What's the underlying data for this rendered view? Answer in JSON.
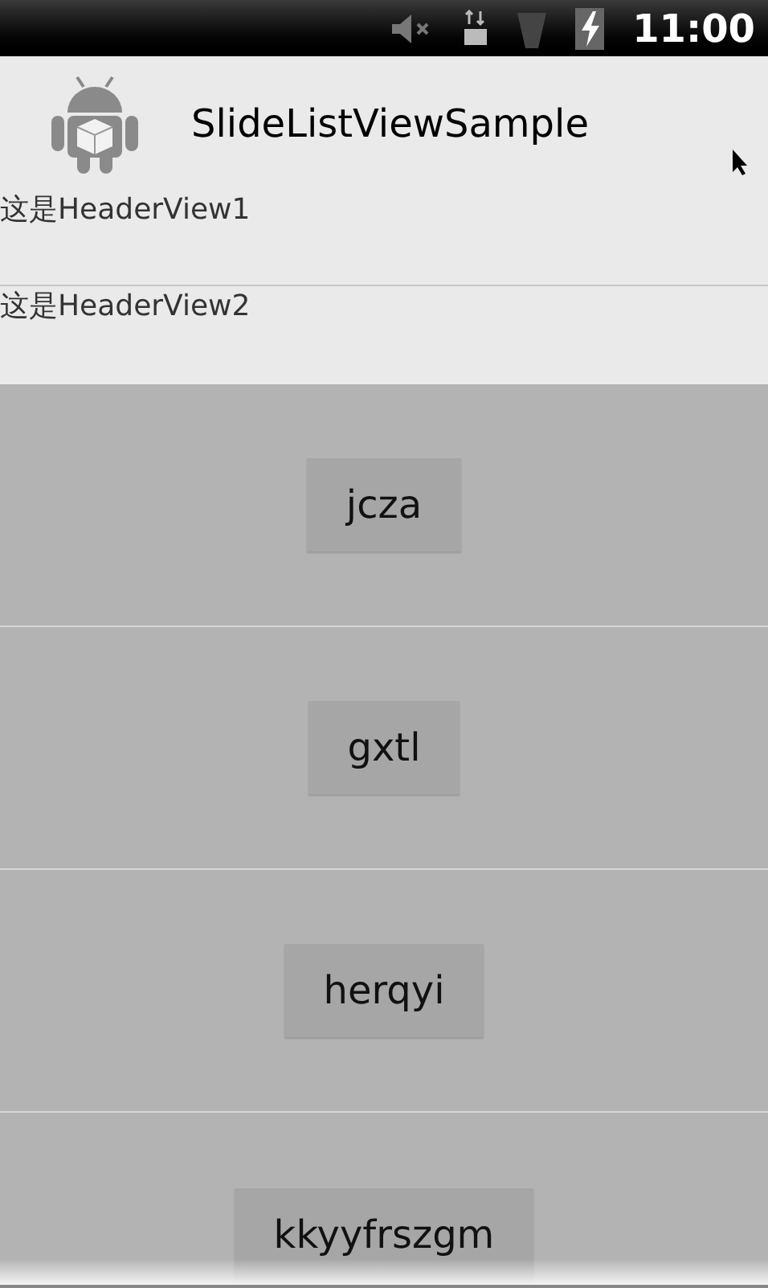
{
  "status_bar": {
    "time": "11:00"
  },
  "title_bar": {
    "title": "SlideListViewSample"
  },
  "headers": [
    "这是HeaderView1",
    "这是HeaderView2"
  ],
  "rows": [
    {
      "button": "jcza"
    },
    {
      "button": "gxtl"
    },
    {
      "button": "herqyi"
    },
    {
      "button": "kkyyfrszgm"
    }
  ]
}
